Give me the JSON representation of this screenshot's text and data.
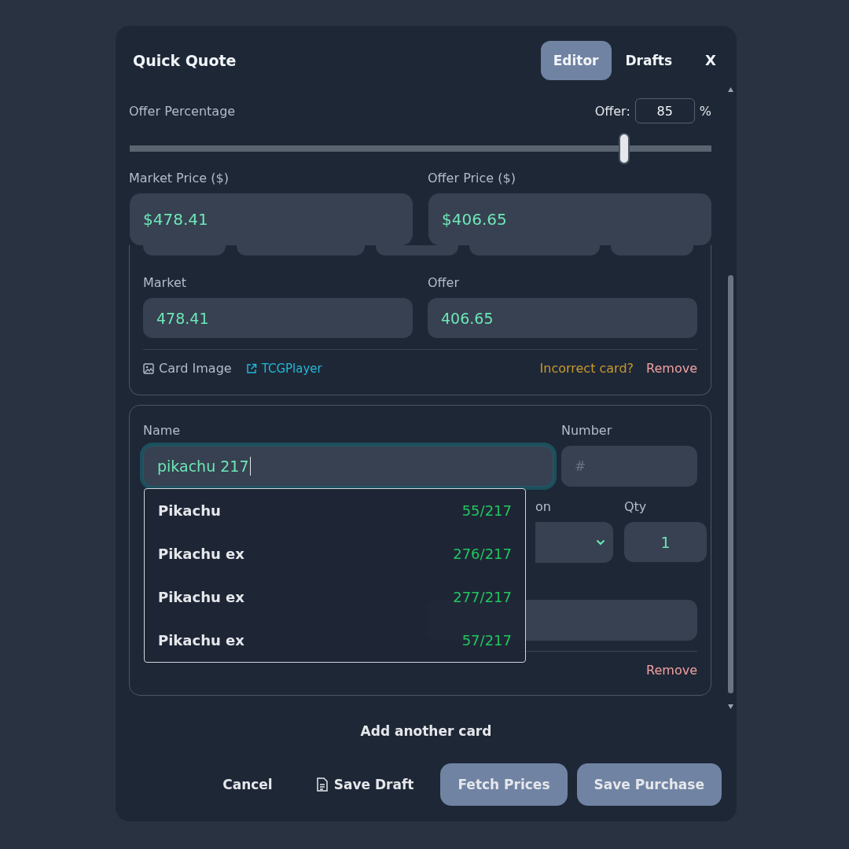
{
  "dialog": {
    "title": "Quick Quote",
    "tabs": [
      {
        "label": "Editor",
        "selected": true
      },
      {
        "label": "Drafts",
        "selected": false
      }
    ],
    "close": "X"
  },
  "offer": {
    "label": "Offer Percentage",
    "input_label": "Offer:",
    "value": "85",
    "unit": "%",
    "level": 0.85
  },
  "prices": [
    {
      "label": "Market Price ($)",
      "value": "$478.41"
    },
    {
      "label": "Offer Price ($)",
      "value": "$406.65"
    }
  ],
  "card_1": {
    "fields": [
      {
        "label": "Market",
        "value": "478.41"
      },
      {
        "label": "Offer",
        "value": "406.65"
      }
    ],
    "image_link": "Card Image",
    "source_link": "TCGPlayer",
    "incorrect": "Incorrect card?",
    "remove": "Remove"
  },
  "card_2": {
    "name": {
      "label": "Name",
      "value": "pikachu 217",
      "focused": true
    },
    "number": {
      "label": "Number",
      "placeholder": "#"
    },
    "condition_label": "on",
    "qty": {
      "label": "Qty",
      "value": "1"
    },
    "remove": "Remove"
  },
  "suggestions": [
    {
      "name": "Pikachu",
      "number": "55/217"
    },
    {
      "name": "Pikachu ex",
      "number": "276/217"
    },
    {
      "name": "Pikachu ex",
      "number": "277/217"
    },
    {
      "name": "Pikachu ex",
      "number": "57/217"
    }
  ],
  "add_card": "Add another card",
  "buttons": [
    {
      "label": "Cancel",
      "kind": "plain"
    },
    {
      "label": "Save Draft",
      "kind": "icon"
    },
    {
      "label": "Fetch Prices",
      "kind": "filled"
    },
    {
      "label": "Save Purchase",
      "kind": "filled"
    }
  ]
}
